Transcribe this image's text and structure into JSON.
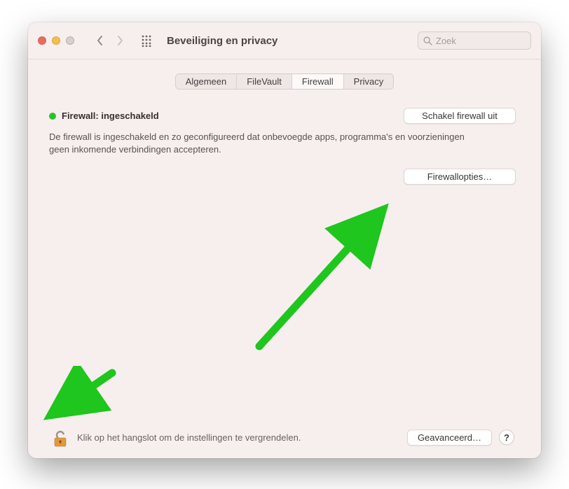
{
  "window": {
    "title": "Beveiliging en privacy"
  },
  "search": {
    "placeholder": "Zoek"
  },
  "tabs": {
    "items": [
      "Algemeen",
      "FileVault",
      "Firewall",
      "Privacy"
    ],
    "active_index": 2
  },
  "firewall": {
    "status_label": "Firewall: ingeschakeld",
    "status_color": "#2cc22c",
    "disable_button": "Schakel firewall uit",
    "description": "De firewall is ingeschakeld en zo geconfigureerd dat onbevoegde apps, programma's en voorzieningen geen inkomende verbindingen accepteren.",
    "options_button": "Firewallopties…"
  },
  "footer": {
    "lock_text": "Klik op het hangslot om de instellingen te vergrendelen.",
    "advanced_button": "Geavanceerd…",
    "help_label": "?"
  },
  "annotations": {
    "arrow_to_options": true,
    "arrow_to_lock": true,
    "color": "#1EC61E"
  }
}
